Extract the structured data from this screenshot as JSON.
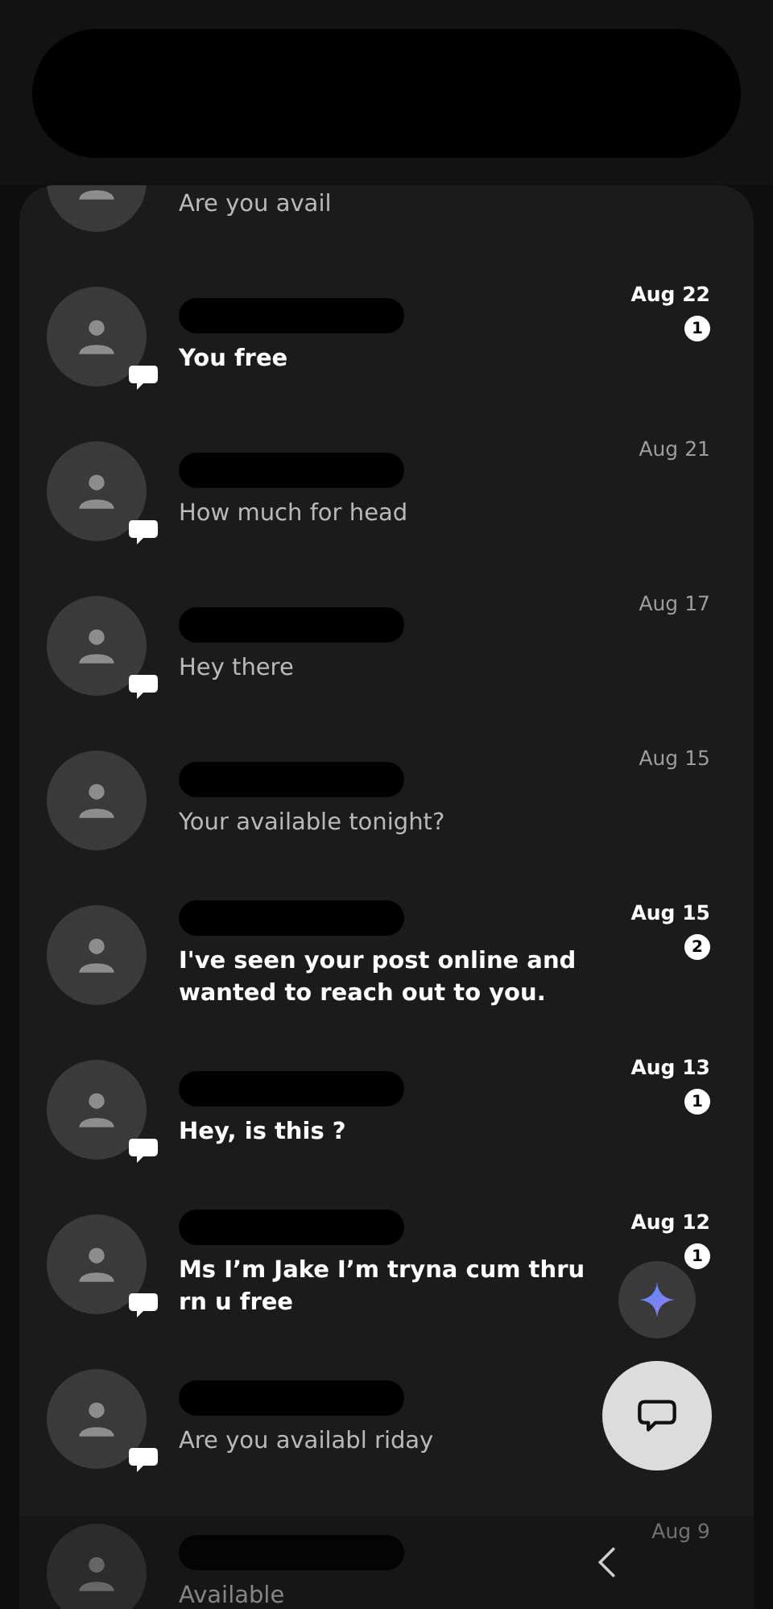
{
  "conversations": [
    {
      "snippet": "Are you avail",
      "unread": false,
      "chat_badge": false
    },
    {
      "snippet": "You free",
      "date": "Aug 22",
      "unread": true,
      "unread_count": "1",
      "chat_badge": true
    },
    {
      "snippet": "How much for head",
      "date": "Aug 21",
      "unread": false,
      "chat_badge": true
    },
    {
      "snippet": "Hey there",
      "date": "Aug 17",
      "unread": false,
      "chat_badge": true
    },
    {
      "snippet": "Your available tonight?",
      "date": "Aug 15",
      "unread": false,
      "chat_badge": false
    },
    {
      "snippet": "I've seen your post online and wanted to reach out to you.",
      "date": "Aug 15",
      "unread": true,
      "unread_count": "2",
      "chat_badge": false
    },
    {
      "snippet": "Hey, is this ?",
      "date": "Aug 13",
      "unread": true,
      "unread_count": "1",
      "chat_badge": true
    },
    {
      "snippet": "Ms I’m Jake I’m tryna cum thru rn u free",
      "date": "Aug 12",
      "unread": true,
      "unread_count": "1",
      "chat_badge": true
    },
    {
      "snippet": "Are you availabl riday",
      "unread": false,
      "chat_badge": true
    },
    {
      "snippet": "Available",
      "date": "Aug 9",
      "unread": false,
      "chat_badge": false
    }
  ]
}
